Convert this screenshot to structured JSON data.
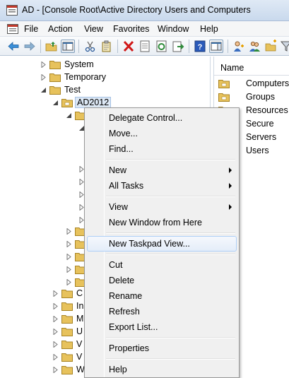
{
  "window": {
    "title": "AD - [Console Root\\Active Directory Users and Computers"
  },
  "menubar": {
    "items": [
      "File",
      "Action",
      "View",
      "Favorites",
      "Window",
      "Help"
    ]
  },
  "toolbar": {
    "buttons": [
      "back-icon",
      "forward-icon",
      "up-folder-icon",
      "show-hide-tree-icon",
      "cut-icon",
      "copy-icon",
      "delete-icon",
      "properties-icon",
      "refresh-icon",
      "export-icon",
      "help-icon",
      "show-action-pane-icon",
      "users-icon",
      "groups-icon",
      "ou-icon",
      "filter-icon"
    ]
  },
  "tree": {
    "items": [
      {
        "label": "System",
        "expander": "collapsed"
      },
      {
        "label": "Temporary",
        "expander": "collapsed"
      },
      {
        "label": "Test",
        "expander": "expanded"
      },
      {
        "label": "AD2012",
        "expander": "expanded",
        "selected": true
      },
      {
        "label": "C",
        "expander": "collapsed"
      },
      {
        "label": "In",
        "expander": "collapsed"
      },
      {
        "label": "M",
        "expander": "collapsed"
      },
      {
        "label": "U",
        "expander": "collapsed"
      },
      {
        "label": "V",
        "expander": "collapsed"
      },
      {
        "label": "V",
        "expander": "collapsed"
      },
      {
        "label": "W",
        "expander": "collapsed"
      }
    ]
  },
  "list": {
    "header": "Name",
    "items": [
      "Computers",
      "Groups",
      "Resources",
      "Secure",
      "Servers",
      "Users"
    ]
  },
  "context_menu": {
    "items": [
      {
        "label": "Delegate Control...",
        "submenu": false
      },
      {
        "label": "Move...",
        "submenu": false
      },
      {
        "label": "Find...",
        "submenu": false
      },
      {
        "separator": true
      },
      {
        "label": "New",
        "submenu": true
      },
      {
        "label": "All Tasks",
        "submenu": true
      },
      {
        "separator": true
      },
      {
        "label": "View",
        "submenu": true
      },
      {
        "label": "New Window from Here",
        "submenu": false
      },
      {
        "separator": true
      },
      {
        "label": "New Taskpad View...",
        "submenu": false,
        "hover": true
      },
      {
        "separator": true
      },
      {
        "label": "Cut",
        "submenu": false
      },
      {
        "label": "Delete",
        "submenu": false
      },
      {
        "label": "Rename",
        "submenu": false
      },
      {
        "label": "Refresh",
        "submenu": false
      },
      {
        "label": "Export List...",
        "submenu": false
      },
      {
        "separator": true
      },
      {
        "label": "Properties",
        "submenu": false
      },
      {
        "separator": true
      },
      {
        "label": "Help",
        "submenu": false
      }
    ]
  },
  "colors": {
    "folder": "#e7c25c",
    "selection": "#dde8f5",
    "menu_hover": "#e4edf9",
    "accent": "#3a6ea5"
  }
}
